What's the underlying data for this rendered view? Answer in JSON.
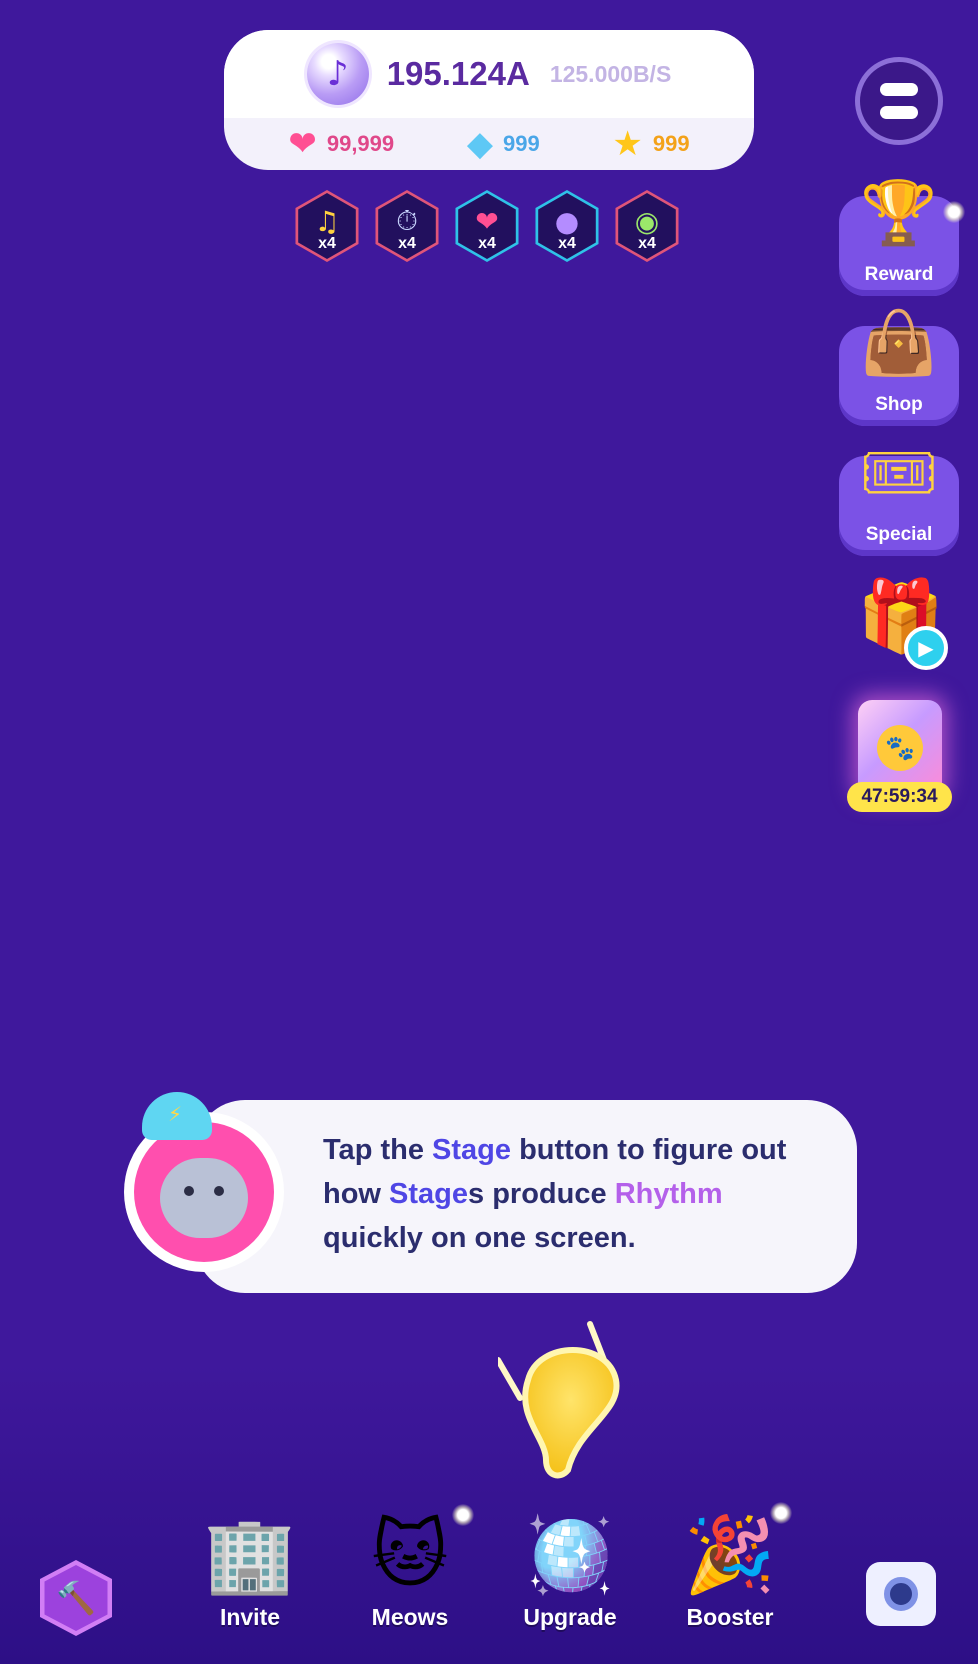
{
  "resources": {
    "rhythm_value": "195.124A",
    "rhythm_rate": "125.000B/S",
    "hearts": "99,999",
    "gems": "999",
    "stars": "999"
  },
  "boosts": [
    {
      "icon": "ticket-note-icon",
      "multiplier": "x4",
      "border": "#e05579"
    },
    {
      "icon": "stopwatch-note-icon",
      "multiplier": "x4",
      "border": "#e05579"
    },
    {
      "icon": "heart-up-icon",
      "multiplier": "x4",
      "border": "#2fc2e8"
    },
    {
      "icon": "orb-up-icon",
      "multiplier": "x4",
      "border": "#2fc2e8"
    },
    {
      "icon": "disco-note-icon",
      "multiplier": "x4",
      "border": "#e05579"
    }
  ],
  "side_buttons": {
    "reward": "Reward",
    "shop": "Shop",
    "special": "Special",
    "pack_timer": "47:59:34"
  },
  "tutorial": {
    "part1": "Tap the ",
    "stage": "Stage",
    "part2": " button to figure out how ",
    "stages": "Stage",
    "part3": "s produce ",
    "rhythm": "Rhythm",
    "part4": " quickly on one screen."
  },
  "nav": {
    "invite": "Invite",
    "meows": "Meows",
    "upgrade": "Upgrade",
    "booster": "Booster"
  },
  "colors": {
    "background": "#3f189c",
    "heart_text": "#e0488a",
    "gem_text": "#4aa6e8",
    "star_text": "#f3a21a",
    "highlight_blue": "#4f46e5",
    "highlight_purple": "#b460ea"
  }
}
